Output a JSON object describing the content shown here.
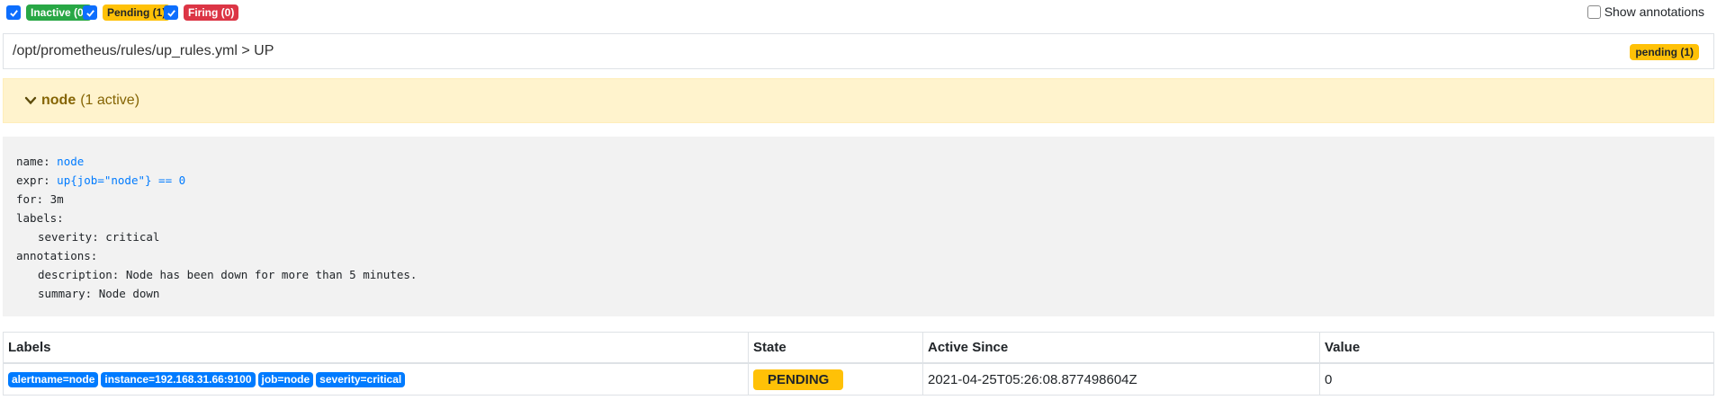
{
  "filters": [
    {
      "label": "Inactive (0)",
      "checked": true,
      "color": "#28a745"
    },
    {
      "label": "Pending (1)",
      "checked": true,
      "color": "#ffc107"
    },
    {
      "label": "Firing (0)",
      "checked": true,
      "color": "#dc3545"
    }
  ],
  "show_annotations": {
    "label": "Show annotations",
    "checked": false
  },
  "rule_file": {
    "path": "/opt/prometheus/rules/up_rules.yml > UP",
    "badge": "pending (1)"
  },
  "group": {
    "name": "node",
    "active": "(1 active)"
  },
  "rule": {
    "name_key": "name:",
    "name_val": "node",
    "expr_key": "expr:",
    "expr_val": "up{job=\"node\"} == 0",
    "for_line": "for: 3m",
    "labels_key": "labels:",
    "severity_line": "severity: critical",
    "annotations_key": "annotations:",
    "description_line": "description: Node has been down for more than 5 minutes.",
    "summary_line": "summary: Node down"
  },
  "table": {
    "headers": {
      "labels": "Labels",
      "state": "State",
      "active_since": "Active Since",
      "value": "Value"
    },
    "rows": [
      {
        "labels": [
          "alertname=node",
          "instance=192.168.31.66:9100",
          "job=node",
          "severity=critical"
        ],
        "state": "PENDING",
        "active_since": "2021-04-25T05:26:08.877498604Z",
        "value": "0"
      }
    ]
  },
  "colors": {
    "accent": "#007bff",
    "pending": "#ffc107",
    "group_bg": "#fff3cd"
  }
}
